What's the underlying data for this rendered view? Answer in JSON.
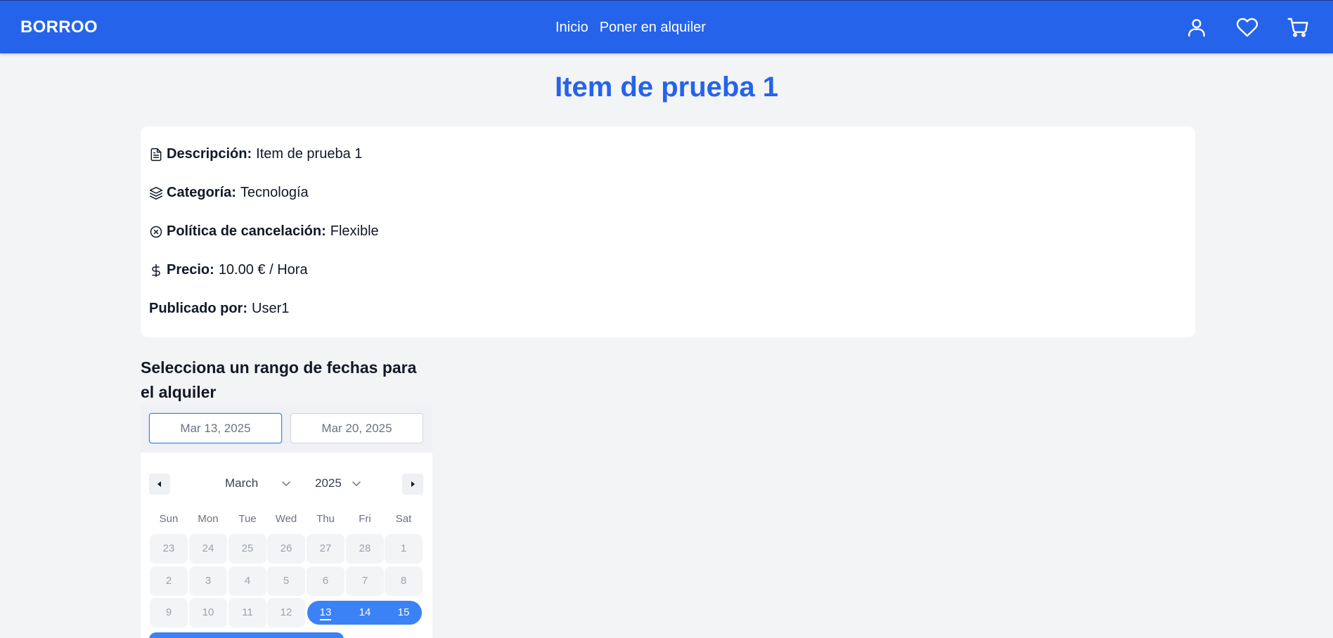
{
  "header": {
    "brand": "BORROO",
    "nav": [
      {
        "label": "Inicio"
      },
      {
        "label": "Poner en alquiler"
      }
    ],
    "icons": [
      "user-icon",
      "heart-icon",
      "cart-icon"
    ]
  },
  "item": {
    "title": "Item de prueba 1",
    "details": {
      "description": {
        "label": "Descripción:",
        "value": "Item de prueba 1",
        "icon": "document-icon"
      },
      "category": {
        "label": "Categoría:",
        "value": "Tecnología",
        "icon": "layers-icon"
      },
      "cancellation": {
        "label": "Política de cancelación:",
        "value": "Flexible",
        "icon": "x-circle-icon"
      },
      "price": {
        "label": "Precio:",
        "value": "10.00 € / Hora",
        "icon": "dollar-icon"
      },
      "publisher": {
        "label": "Publicado por:",
        "value": "User1"
      }
    }
  },
  "booking": {
    "title": "Selecciona un rango de fechas para el alquiler",
    "start_date": "Mar 13, 2025",
    "end_date": "Mar 20, 2025",
    "calendar": {
      "month": "March",
      "year": "2025",
      "weekdays": [
        "Sun",
        "Mon",
        "Tue",
        "Wed",
        "Thu",
        "Fri",
        "Sat"
      ],
      "rows": [
        [
          "23",
          "24",
          "25",
          "26",
          "27",
          "28",
          "1"
        ],
        [
          "2",
          "3",
          "4",
          "5",
          "6",
          "7",
          "8"
        ],
        [
          "9",
          "10",
          "11",
          "12",
          "13",
          "14",
          "15"
        ]
      ]
    }
  },
  "colors": {
    "primary": "#2563eb",
    "accent": "#3b82f6",
    "background": "#f3f4f6"
  }
}
